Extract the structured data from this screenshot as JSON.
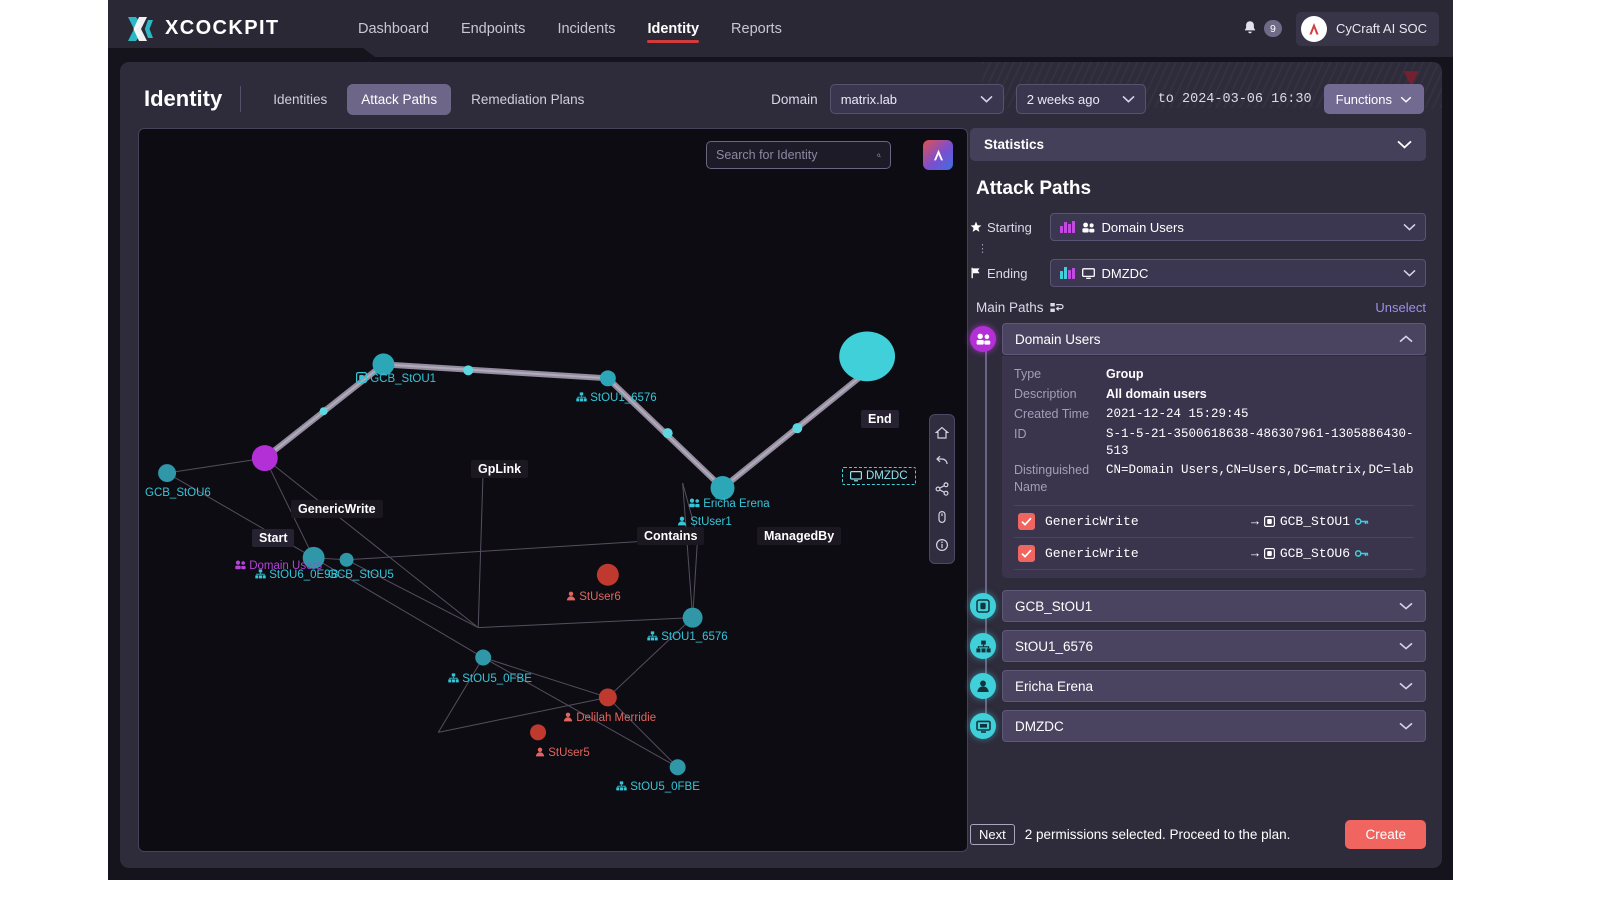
{
  "brand": {
    "name": "XCOCKPIT",
    "logo_icon": "x-logo-icon"
  },
  "topnav": {
    "items": [
      {
        "label": "Dashboard",
        "active": false
      },
      {
        "label": "Endpoints",
        "active": false
      },
      {
        "label": "Incidents",
        "active": false
      },
      {
        "label": "Identity",
        "active": true
      },
      {
        "label": "Reports",
        "active": false
      }
    ],
    "notification_count": "9",
    "user": "CyCraft AI SOC"
  },
  "subheader": {
    "page_title": "Identity",
    "tabs": [
      {
        "label": "Identities",
        "active": false
      },
      {
        "label": "Attack Paths",
        "active": true
      },
      {
        "label": "Remediation Plans",
        "active": false
      }
    ],
    "domain_label": "Domain",
    "domain_value": "matrix.lab",
    "time_value": "2 weeks ago",
    "time_to": "to 2024-03-06 16:30",
    "functions_label": "Functions"
  },
  "graph": {
    "search_placeholder": "Search for Identity",
    "search_value": "",
    "ai_button": "ai-assistant-icon",
    "tools": [
      "home-icon",
      "undo-icon",
      "share-graph-icon",
      "mouse-pointer-icon",
      "info-icon"
    ],
    "start_label": "Start",
    "end_label": "End",
    "edge_labels": [
      "GenericWrite",
      "GpLink",
      "Contains",
      "ManagedBy"
    ],
    "nodes": [
      {
        "label": "Domain Users",
        "color": "magenta",
        "icon": "group-icon"
      },
      {
        "label": "GCB_StOU1",
        "color": "cyan",
        "icon": "container-icon"
      },
      {
        "label": "StOU1_6576",
        "color": "cyan",
        "icon": "ou-icon"
      },
      {
        "label": "DMZDC",
        "color": "cyan",
        "icon": "computer-icon"
      },
      {
        "label": "GCB_StOU6",
        "color": "cyan",
        "icon": "none"
      },
      {
        "label": "StOU6_0E9B",
        "color": "cyan",
        "icon": "ou-icon"
      },
      {
        "label": "GCB_StOU5",
        "color": "cyan",
        "icon": "container-icon"
      },
      {
        "label": "Ericha Erena",
        "color": "cyan",
        "icon": "user-icon"
      },
      {
        "label": "StUser1",
        "color": "cyan",
        "icon": "user-icon"
      },
      {
        "label": "StUser6",
        "color": "red",
        "icon": "user-icon"
      },
      {
        "label": "StOU1_6576",
        "color": "cyan",
        "icon": "ou-icon"
      },
      {
        "label": "StOU5_0FBE",
        "color": "cyan",
        "icon": "ou-icon"
      },
      {
        "label": "Delilah Merridie",
        "color": "red",
        "icon": "user-icon"
      },
      {
        "label": "StUser5",
        "color": "red",
        "icon": "user-icon"
      },
      {
        "label": "StOU5_0FBE",
        "color": "cyan",
        "icon": "ou-icon"
      }
    ]
  },
  "panel": {
    "statistics_label": "Statistics",
    "attack_paths_title": "Attack Paths",
    "starting_label": "Starting",
    "starting_value": "Domain Users",
    "ending_label": "Ending",
    "ending_value": "DMZDC",
    "main_paths_label": "Main Paths",
    "unselect_label": "Unselect",
    "selected_node": {
      "name": "Domain Users",
      "details": [
        {
          "key": "Type",
          "value": "Group"
        },
        {
          "key": "Description",
          "value": "All domain users"
        },
        {
          "key": "Created Time",
          "value": "2021-12-24 15:29:45"
        },
        {
          "key": "ID",
          "value": "S-1-5-21-3500618638-486307961-1305886430-513"
        },
        {
          "key": "Distinguished Name",
          "value": "CN=Domain Users,CN=Users,DC=matrix,DC=lab"
        }
      ],
      "permissions": [
        {
          "name": "GenericWrite",
          "arrow": "→",
          "target": "GCB_StOU1",
          "checked": true
        },
        {
          "name": "GenericWrite",
          "arrow": "→",
          "target": "GCB_StOU6",
          "checked": true
        }
      ]
    },
    "path_nodes": [
      {
        "name": "GCB_StOU1",
        "icon": "container-icon"
      },
      {
        "name": "StOU1_6576",
        "icon": "ou-icon"
      },
      {
        "name": "Ericha Erena",
        "icon": "user-icon"
      },
      {
        "name": "DMZDC",
        "icon": "computer-icon"
      }
    ],
    "footer": {
      "next_label": "Next",
      "message": "2 permissions selected. Proceed to the plan.",
      "create_label": "Create"
    }
  },
  "colors": {
    "accent_red": "#f0655f",
    "accent_cyan": "#3fd0da",
    "accent_magenta": "#b32fd6",
    "link_purple": "#9f8fe8",
    "panel_bg": "#2e2b3b"
  }
}
